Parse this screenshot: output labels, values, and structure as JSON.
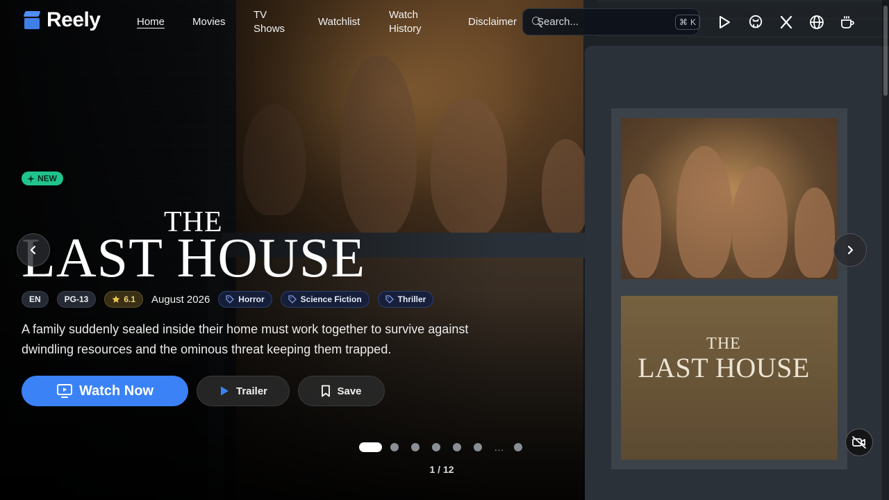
{
  "app": {
    "name": "Reely"
  },
  "nav": {
    "items": [
      {
        "label": "Home",
        "active": true
      },
      {
        "label": "Movies"
      },
      {
        "label": "TV Shows"
      },
      {
        "label": "Watchlist"
      },
      {
        "label": "Watch History"
      },
      {
        "label": "Disclaimer"
      }
    ]
  },
  "search": {
    "placeholder": "Search...",
    "shortcut_symbol": "⌘",
    "shortcut_key": "K"
  },
  "header_icons": [
    "play-store-icon",
    "github-icon",
    "x-icon",
    "globe-icon",
    "coffee-cup-icon"
  ],
  "hero": {
    "badge": "NEW",
    "title_top": "THE",
    "title_main": "LAST HOUSE",
    "language": "EN",
    "certification": "PG-13",
    "rating": "6.1",
    "release": "August 2026",
    "genres": [
      "Horror",
      "Science Fiction",
      "Thriller"
    ],
    "overview": "A family suddenly sealed inside their home must work together to survive against dwindling resources and the ominous threat keeping them trapped.",
    "buttons": {
      "watch": "Watch Now",
      "trailer": "Trailer",
      "save": "Save"
    },
    "poster": {
      "title_top": "THE",
      "title_main": "LAST HOUSE"
    }
  },
  "carousel": {
    "ellipsis": "...",
    "counter": "1 / 12",
    "current": 1,
    "total": 12
  },
  "colors": {
    "accent": "#3b82f6",
    "new_badge": "#20c48d",
    "rating": "#f3d36a",
    "genre_pill": "#16203c"
  }
}
